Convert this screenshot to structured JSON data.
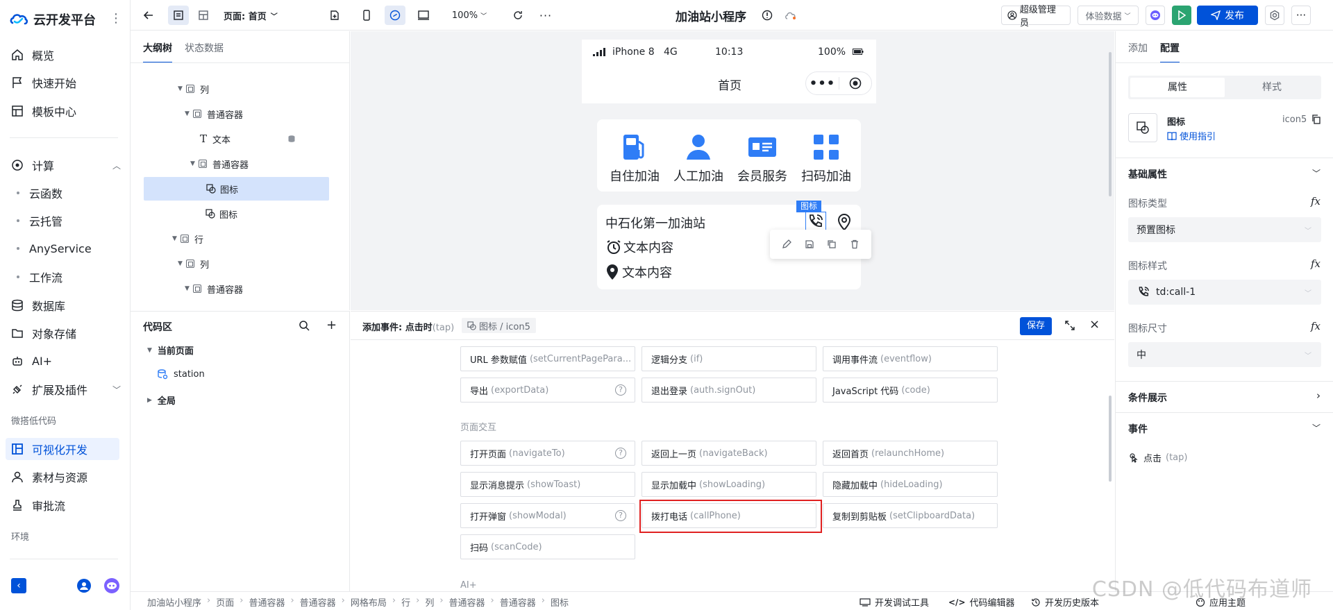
{
  "leftnav": {
    "brand": "云开发平台",
    "items": {
      "overview": "概览",
      "quickstart": "快速开始",
      "templates": "模板中心",
      "compute": "计算",
      "cloud_func": "云函数",
      "cloud_host": "云托管",
      "anyservice": "AnyService",
      "workflow": "工作流",
      "database": "数据库",
      "storage": "对象存储",
      "ai": "AI+",
      "extensions": "扩展及插件",
      "lowcode_section": "微搭低代码",
      "visual_dev": "可视化开发",
      "assets": "素材与资源",
      "approval": "审批流",
      "env_section": "环境"
    }
  },
  "topbar": {
    "page_label": "页面: 首页",
    "zoom": "100%",
    "app_title": "加油站小程序",
    "admin": "超级管理员",
    "data_mode": "体验数据",
    "publish": "发布"
  },
  "outline": {
    "tabs": [
      "大纲树",
      "状态数据"
    ],
    "rows": [
      "列",
      "普通容器",
      "文本",
      "普通容器",
      "图标",
      "图标",
      "行",
      "列",
      "普通容器"
    ]
  },
  "codearea": {
    "title": "代码区",
    "current_page": "当前页面",
    "station": "station",
    "global": "全局"
  },
  "phone": {
    "carrier": "iPhone 8",
    "network": "4G",
    "time": "10:13",
    "battery": "100%",
    "nav_title": "首页",
    "services": [
      "自住加油",
      "人工加油",
      "会员服务",
      "扫码加油"
    ],
    "station_name": "中石化第一加油站",
    "text1": "文本内容",
    "text2": "文本内容",
    "selected_tag": "图标"
  },
  "event": {
    "title": "添加事件: 点击时",
    "title_en": "(tap)",
    "target": "图标 / icon5",
    "save": "保存",
    "group_page": "页面交互",
    "group_ai": "AI+",
    "row1": [
      {
        "cn": "URL 参数赋值",
        "en": "(setCurrentPagePara..."
      },
      {
        "cn": "逻辑分支",
        "en": "(if)"
      },
      {
        "cn": "调用事件流",
        "en": "(eventflow)"
      }
    ],
    "row2": [
      {
        "cn": "导出",
        "en": "(exportData)"
      },
      {
        "cn": "退出登录",
        "en": "(auth.signOut)"
      },
      {
        "cn": "JavaScript 代码",
        "en": "(code)"
      }
    ],
    "row3": [
      {
        "cn": "打开页面",
        "en": "(navigateTo)"
      },
      {
        "cn": "返回上一页",
        "en": "(navigateBack)"
      },
      {
        "cn": "返回首页",
        "en": "(relaunchHome)"
      }
    ],
    "row4": [
      {
        "cn": "显示消息提示",
        "en": "(showToast)"
      },
      {
        "cn": "显示加载中",
        "en": "(showLoading)"
      },
      {
        "cn": "隐藏加载中",
        "en": "(hideLoading)"
      }
    ],
    "row5": [
      {
        "cn": "打开弹窗",
        "en": "(showModal)"
      },
      {
        "cn": "拨打电话",
        "en": "(callPhone)"
      },
      {
        "cn": "复制到剪贴板",
        "en": "(setClipboardData)"
      }
    ],
    "row6": [
      {
        "cn": "扫码",
        "en": "(scanCode)"
      }
    ],
    "help_mark": "?"
  },
  "rpanel": {
    "tabs": [
      "添加",
      "配置"
    ],
    "seg": [
      "属性",
      "样式"
    ],
    "comp_name": "图标",
    "comp_id": "icon5",
    "guide": "使用指引",
    "basic": "基础属性",
    "icon_type_label": "图标类型",
    "icon_type_value": "预置图标",
    "icon_style_label": "图标样式",
    "icon_style_value": "td:call-1",
    "icon_size_label": "图标尺寸",
    "icon_size_value": "中",
    "cond": "条件展示",
    "events": "事件",
    "tap": "点击",
    "tap_en": "(tap)",
    "fx": "fx"
  },
  "bottombar": {
    "crumbs": [
      "加油站小程序",
      "页面",
      "普通容器",
      "普通容器",
      "网格布局",
      "行",
      "列",
      "普通容器",
      "普通容器",
      "图标"
    ],
    "devtools": "开发调试工具",
    "code_editor": "代码编辑器",
    "history": "开发历史版本",
    "theme": "应用主题"
  },
  "watermark": "CSDN @低代码布道师",
  "colors": {
    "primary": "#0052d9",
    "service_icon": "#2f7df6",
    "highlight": "#e02020",
    "run_green": "#2ba471"
  }
}
